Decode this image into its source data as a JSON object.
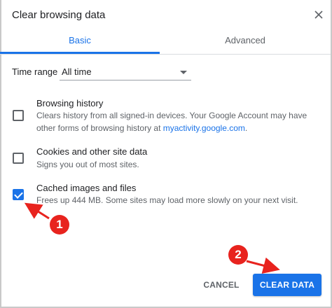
{
  "dialog": {
    "title": "Clear browsing data",
    "close_icon": "close-icon"
  },
  "tabs": [
    {
      "label": "Basic",
      "active": true
    },
    {
      "label": "Advanced",
      "active": false
    }
  ],
  "time_range": {
    "label": "Time range",
    "value": "All time"
  },
  "options": [
    {
      "title": "Browsing history",
      "desc_line1": "Clears history from all signed-in devices. Your Google Account may have",
      "desc_line2_prefix": "other forms of browsing history at ",
      "desc_link": "myactivity.google.com",
      "desc_line2_suffix": ".",
      "checked": false
    },
    {
      "title": "Cookies and other site data",
      "desc": "Signs you out of most sites.",
      "checked": false
    },
    {
      "title": "Cached images and files",
      "desc": "Frees up 444 MB. Some sites may load more slowly on your next visit.",
      "checked": true
    }
  ],
  "buttons": {
    "cancel": "CANCEL",
    "clear": "CLEAR DATA"
  },
  "annotations": [
    {
      "number": "1"
    },
    {
      "number": "2"
    }
  ],
  "colors": {
    "accent": "#1a73e8",
    "annotation": "#e8231e",
    "text_primary": "#202124",
    "text_secondary": "#5f6368"
  }
}
